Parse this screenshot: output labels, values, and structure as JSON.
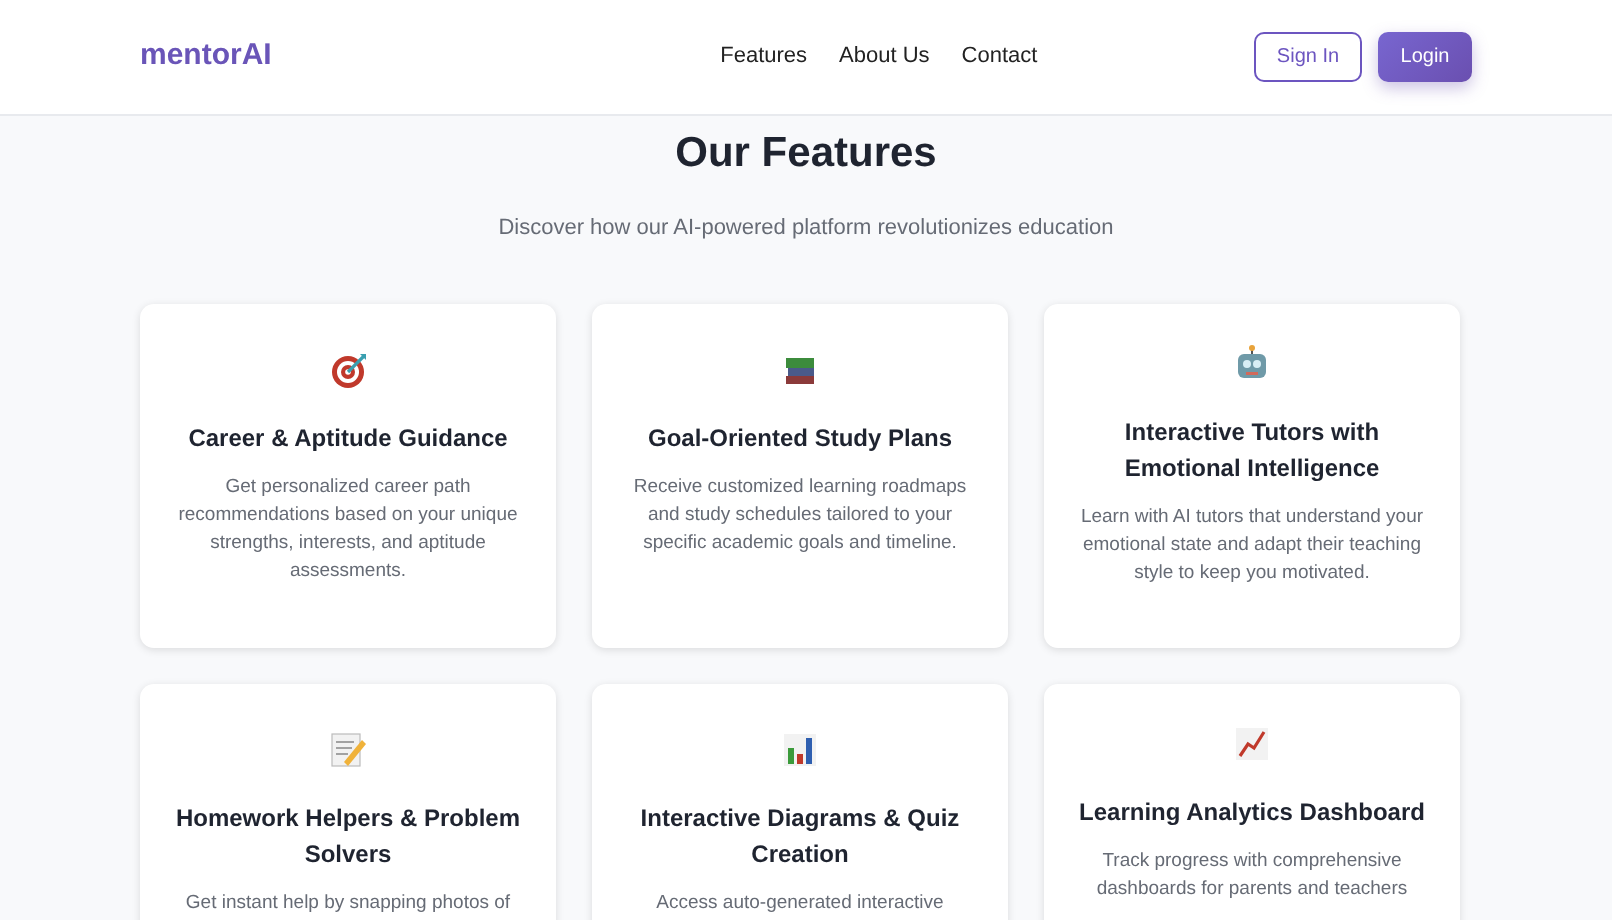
{
  "navbar": {
    "brand": "mentorAI",
    "links": [
      {
        "label": "Features"
      },
      {
        "label": "About Us"
      },
      {
        "label": "Contact"
      }
    ],
    "buttons": [
      {
        "label": "Sign In",
        "kind": "outline"
      },
      {
        "label": "Login",
        "kind": "filled"
      }
    ]
  },
  "section": {
    "title": "Our Features",
    "subtitle": "Discover how our AI-powered platform revolutionizes education",
    "cards": [
      {
        "title": "Career & Aptitude Guidance",
        "description": "Get personalized career path recommendations based on your unique strengths, interests, and aptitude assessments."
      },
      {
        "title": "Goal-Oriented Study Plans",
        "description": "Receive customized learning roadmaps and study schedules tailored to your specific academic goals and timeline."
      },
      {
        "title": "Interactive Tutors with Emotional Intelligence",
        "description": "Learn with AI tutors that understand your emotional state and adapt their teaching style to keep you motivated."
      },
      {
        "title": "Homework Helpers & Problem Solvers",
        "description": "Get instant help by snapping photos of"
      },
      {
        "title": "Interactive Diagrams & Quiz Creation",
        "description": "Access auto-generated interactive"
      },
      {
        "title": "Learning Analytics Dashboard",
        "description": "Track progress with comprehensive dashboards for parents and teachers"
      }
    ]
  }
}
